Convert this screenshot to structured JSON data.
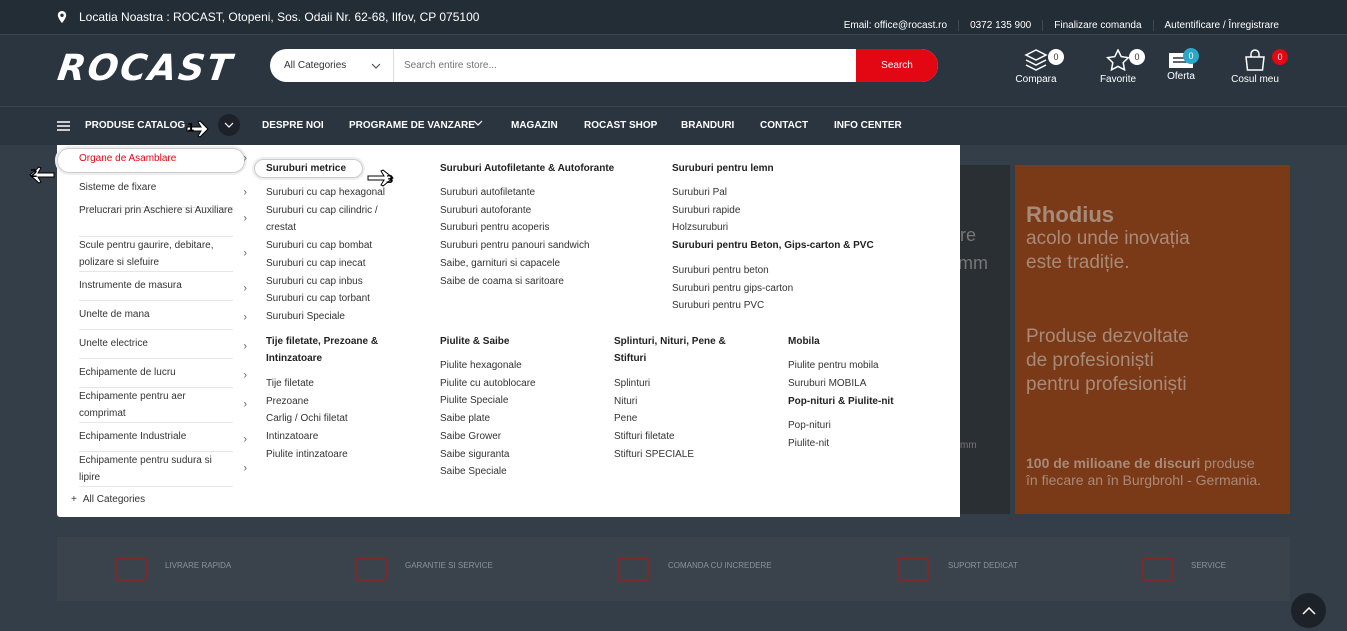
{
  "topbar": {
    "location": "Locatia Noastra : ROCAST, Otopeni, Sos. Odaii Nr. 62-68, Ilfov, CP 075100",
    "links": [
      "Email: office@rocast.ro",
      "0372 135 900",
      "Finalizare comanda",
      "Autentificare / Înregistrare"
    ]
  },
  "header": {
    "logo": "ROCAST",
    "search": {
      "category": "All Categories",
      "placeholder": "Search entire store...",
      "button": "Search"
    },
    "icons": [
      {
        "label": "Compara",
        "count": "0"
      },
      {
        "label": "Favorite",
        "count": "0"
      },
      {
        "label": "Oferta",
        "count": "0"
      },
      {
        "label": "Cosul meu",
        "count": "0"
      }
    ]
  },
  "nav": {
    "catalog": "PRODUSE CATALOG",
    "items": [
      "DESPRE NOI",
      "PROGRAME DE VANZARE",
      "MAGAZIN",
      "ROCAST SHOP",
      "BRANDURI",
      "CONTACT",
      "INFO CENTER"
    ]
  },
  "markers": [
    "1",
    "2",
    "3"
  ],
  "sidebar": {
    "items": [
      "Organe de Asamblare",
      "Sisteme de fixare",
      "Prelucrari prin Aschiere si Auxiliare",
      "Scule pentru gaurire, debitare, polizare si slefuire",
      "Instrumente de masura",
      "Unelte de mana",
      "Unelte electrice",
      "Echipamente de lucru",
      "Echipamente pentru aer comprimat",
      "Echipamente Industriale",
      "Echipamente pentru sudura si lipire"
    ],
    "all": "All Categories"
  },
  "mega": {
    "col1": {
      "h1": "Suruburi metrice",
      "items1": [
        "Suruburi cu cap hexagonal",
        "Suruburi cu cap cilindric / crestat",
        "Suruburi cu cap bombat",
        "Suruburi cu cap inecat",
        "Suruburi cu cap inbus",
        "Suruburi cu cap torbant",
        "Suruburi Speciale"
      ],
      "h2": "Tije filetate, Prezoane & Intinzatoare",
      "items2": [
        "Tije filetate",
        "Prezoane",
        "Carlig / Ochi filetat",
        "Intinzatoare",
        "Piulite intinzatoare"
      ]
    },
    "col2": {
      "h1": "Suruburi Autofiletante & Autoforante",
      "items1": [
        "Suruburi autofiletante",
        "Suruburi autoforante",
        "Suruburi pentru acoperis",
        "Suruburi pentru panouri sandwich",
        "Saibe, garnituri si capacele",
        "Saibe de coama si saritoare"
      ],
      "h2": "Piulite & Saibe",
      "items2": [
        "Piulite hexagonale",
        "Piulite cu autoblocare",
        "Piulite Speciale",
        "Saibe plate",
        "Saibe Grower",
        "Saibe siguranta",
        "Saibe Speciale"
      ]
    },
    "col3": {
      "h1": "Suruburi pentru lemn",
      "items1": [
        "Suruburi Pal",
        "Suruburi rapide",
        "Holzsuruburi"
      ],
      "h2": "Suruburi pentru Beton, Gips-carton & PVC",
      "items2": [
        "Suruburi pentru beton",
        "Suruburi pentru gips-carton",
        "Suruburi pentru PVC"
      ],
      "h3": "Splinturi, Nituri, Pene & Stifturi",
      "items3": [
        "Splinturi",
        "Nituri",
        "Pene",
        "Stifturi filetate",
        "Stifturi SPECIALE"
      ]
    },
    "col4": {
      "h1": "Mobila",
      "items1": [
        "Piulite pentru mobila",
        "Suruburi MOBILA"
      ],
      "h2": "Pop-nituri & Piulite-nit",
      "items2": [
        "Pop-nituri",
        "Piulite-nit"
      ]
    }
  },
  "banner": {
    "title": "Rhodius",
    "line1": "acolo unde inovația",
    "line2": "este tradiție.",
    "line3": "Produse dezvoltate",
    "line4": "de profesioniști",
    "line5": "pentru profesioniști",
    "bold": "100 de milioane de discuri",
    "rest1": " produse",
    "rest2": "în fiecare an în Burgbrohl - Germania.",
    "partial1": "re",
    "partial2": "mm",
    "partial3": "mm"
  },
  "features": [
    "LIVRARE RAPIDA",
    "GARANTIE SI SERVICE",
    "COMANDA CU INCREDERE",
    "SUPORT DEDICAT",
    "SERVICE"
  ],
  "colors": {
    "accent": "#e30613",
    "bg": "#232d36"
  }
}
